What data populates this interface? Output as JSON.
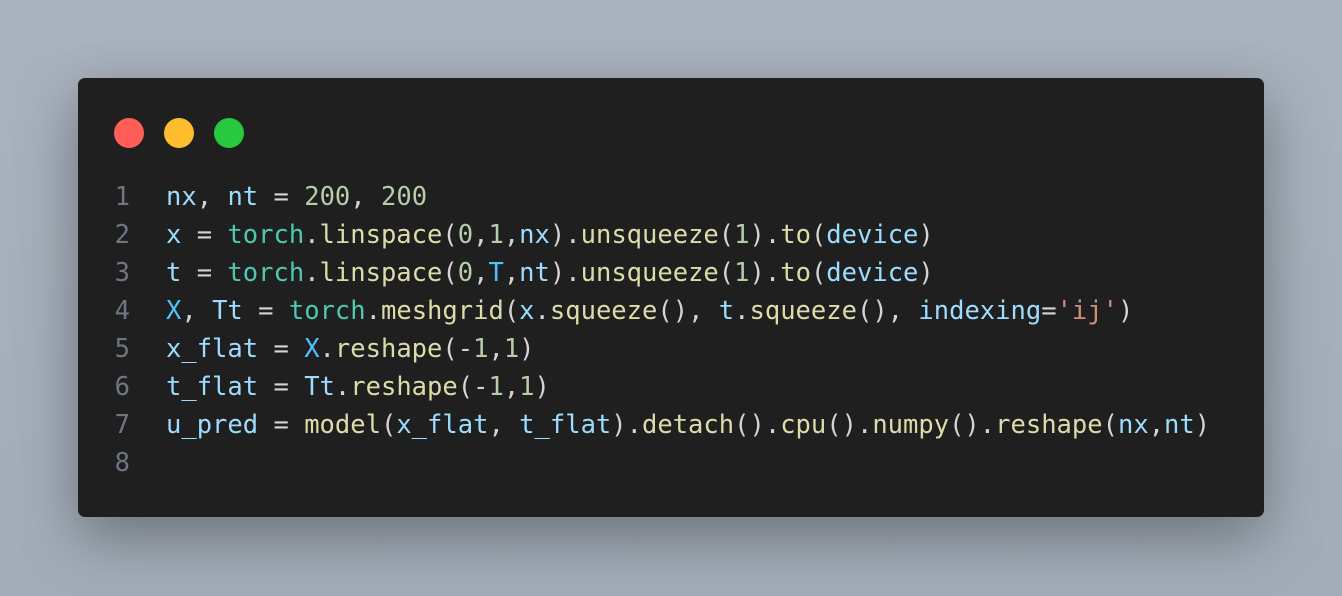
{
  "window": {
    "controls": [
      {
        "name": "close",
        "color": "#ff5f56"
      },
      {
        "name": "minimize",
        "color": "#ffbd2e"
      },
      {
        "name": "maximize",
        "color": "#27c93f"
      }
    ]
  },
  "colors": {
    "var": "#9cdcfe",
    "fn": "#dcdcaa",
    "cls": "#4ec9b0",
    "num": "#b5cea8",
    "const": "#4fc1ff",
    "str": "#ce9178",
    "txt": "#d4d4d4"
  },
  "code": {
    "lines": [
      {
        "number": "1",
        "tokens": [
          [
            "nx",
            "var"
          ],
          [
            ", ",
            "txt"
          ],
          [
            "nt",
            "var"
          ],
          [
            " = ",
            "txt"
          ],
          [
            "200",
            "num"
          ],
          [
            ", ",
            "txt"
          ],
          [
            "200",
            "num"
          ]
        ]
      },
      {
        "number": "2",
        "tokens": [
          [
            "x",
            "var"
          ],
          [
            " = ",
            "txt"
          ],
          [
            "torch",
            "cls"
          ],
          [
            ".",
            "txt"
          ],
          [
            "linspace",
            "fn"
          ],
          [
            "(",
            "txt"
          ],
          [
            "0",
            "num"
          ],
          [
            ",",
            "txt"
          ],
          [
            "1",
            "num"
          ],
          [
            ",",
            "txt"
          ],
          [
            "nx",
            "var"
          ],
          [
            ").",
            "txt"
          ],
          [
            "unsqueeze",
            "fn"
          ],
          [
            "(",
            "txt"
          ],
          [
            "1",
            "num"
          ],
          [
            ").",
            "txt"
          ],
          [
            "to",
            "fn"
          ],
          [
            "(",
            "txt"
          ],
          [
            "device",
            "var"
          ],
          [
            ")",
            "txt"
          ]
        ]
      },
      {
        "number": "3",
        "tokens": [
          [
            "t",
            "var"
          ],
          [
            " = ",
            "txt"
          ],
          [
            "torch",
            "cls"
          ],
          [
            ".",
            "txt"
          ],
          [
            "linspace",
            "fn"
          ],
          [
            "(",
            "txt"
          ],
          [
            "0",
            "num"
          ],
          [
            ",",
            "txt"
          ],
          [
            "T",
            "const"
          ],
          [
            ",",
            "txt"
          ],
          [
            "nt",
            "var"
          ],
          [
            ").",
            "txt"
          ],
          [
            "unsqueeze",
            "fn"
          ],
          [
            "(",
            "txt"
          ],
          [
            "1",
            "num"
          ],
          [
            ").",
            "txt"
          ],
          [
            "to",
            "fn"
          ],
          [
            "(",
            "txt"
          ],
          [
            "device",
            "var"
          ],
          [
            ")",
            "txt"
          ]
        ]
      },
      {
        "number": "4",
        "tokens": [
          [
            "X",
            "const"
          ],
          [
            ", ",
            "txt"
          ],
          [
            "Tt",
            "var"
          ],
          [
            " = ",
            "txt"
          ],
          [
            "torch",
            "cls"
          ],
          [
            ".",
            "txt"
          ],
          [
            "meshgrid",
            "fn"
          ],
          [
            "(",
            "txt"
          ],
          [
            "x",
            "var"
          ],
          [
            ".",
            "txt"
          ],
          [
            "squeeze",
            "fn"
          ],
          [
            "(), ",
            "txt"
          ],
          [
            "t",
            "var"
          ],
          [
            ".",
            "txt"
          ],
          [
            "squeeze",
            "fn"
          ],
          [
            "(), ",
            "txt"
          ],
          [
            "indexing",
            "var"
          ],
          [
            "=",
            "txt"
          ],
          [
            "'ij'",
            "str"
          ],
          [
            ")",
            "txt"
          ]
        ]
      },
      {
        "number": "5",
        "tokens": [
          [
            "x_flat",
            "var"
          ],
          [
            " = ",
            "txt"
          ],
          [
            "X",
            "const"
          ],
          [
            ".",
            "txt"
          ],
          [
            "reshape",
            "fn"
          ],
          [
            "(-",
            "txt"
          ],
          [
            "1",
            "num"
          ],
          [
            ",",
            "txt"
          ],
          [
            "1",
            "num"
          ],
          [
            ")",
            "txt"
          ]
        ]
      },
      {
        "number": "6",
        "tokens": [
          [
            "t_flat",
            "var"
          ],
          [
            " = ",
            "txt"
          ],
          [
            "Tt",
            "var"
          ],
          [
            ".",
            "txt"
          ],
          [
            "reshape",
            "fn"
          ],
          [
            "(-",
            "txt"
          ],
          [
            "1",
            "num"
          ],
          [
            ",",
            "txt"
          ],
          [
            "1",
            "num"
          ],
          [
            ")",
            "txt"
          ]
        ]
      },
      {
        "number": "7",
        "tokens": [
          [
            "u_pred",
            "var"
          ],
          [
            " = ",
            "txt"
          ],
          [
            "model",
            "fn"
          ],
          [
            "(",
            "txt"
          ],
          [
            "x_flat",
            "var"
          ],
          [
            ", ",
            "txt"
          ],
          [
            "t_flat",
            "var"
          ],
          [
            ").",
            "txt"
          ],
          [
            "detach",
            "fn"
          ],
          [
            "().",
            "txt"
          ],
          [
            "cpu",
            "fn"
          ],
          [
            "().",
            "txt"
          ],
          [
            "numpy",
            "fn"
          ],
          [
            "().",
            "txt"
          ],
          [
            "reshape",
            "fn"
          ],
          [
            "(",
            "txt"
          ],
          [
            "nx",
            "var"
          ],
          [
            ",",
            "txt"
          ],
          [
            "nt",
            "var"
          ],
          [
            ")",
            "txt"
          ]
        ]
      },
      {
        "number": "8",
        "tokens": []
      }
    ]
  }
}
